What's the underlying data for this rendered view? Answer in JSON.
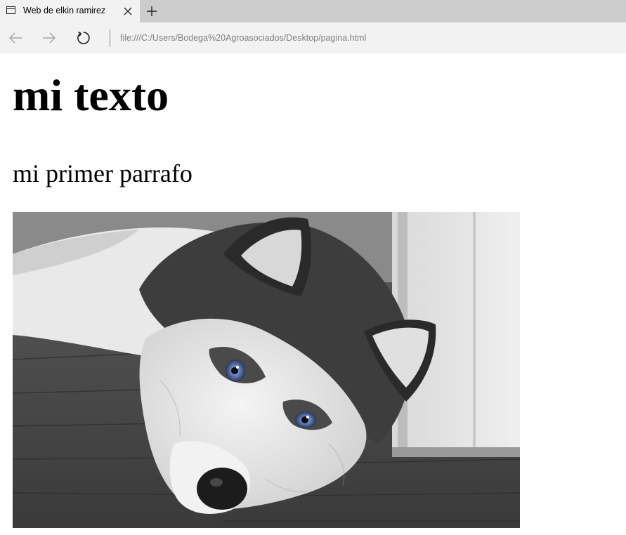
{
  "browser": {
    "tab": {
      "title": "Web de elkin ramirez",
      "icon": "page-icon"
    },
    "new_tab_icon": "plus-icon",
    "close_icon": "close-icon",
    "nav": {
      "back_icon": "back-arrow-icon",
      "forward_icon": "forward-arrow-icon",
      "refresh_icon": "refresh-icon"
    },
    "address": "file:///C:/Users/Bodega%20Agroasociados/Desktop/pagina.html"
  },
  "page": {
    "heading": "mi texto",
    "paragraph": "mi primer parrafo",
    "image": {
      "subject": "grayscale photo of a husky dog lying on a wooden floor with blue eyes"
    }
  },
  "colors": {
    "tabstrip_bg": "#cccccc",
    "active_tab_bg": "#f2f2f2",
    "toolbar_bg": "#f2f2f2",
    "address_text": "#808080",
    "eye_color": "#6f8fd6"
  }
}
